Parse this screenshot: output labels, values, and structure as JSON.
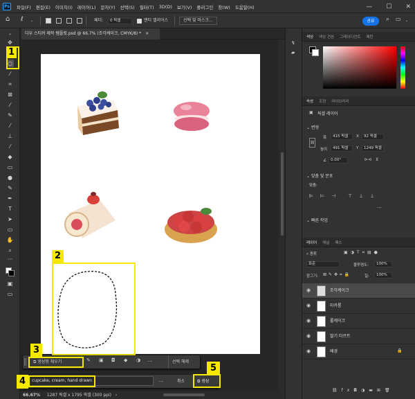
{
  "menu": {
    "items": [
      "파일(F)",
      "편집(E)",
      "이미지(I)",
      "레이어(L)",
      "문자(Y)",
      "선택(S)",
      "필터(T)",
      "3D(D)",
      "보기(V)",
      "플러그인",
      "창(W)",
      "도움말(H)"
    ],
    "logo": "Ps"
  },
  "window_controls": {
    "minimize": "—",
    "maximize": "☐",
    "close": "✕"
  },
  "options": {
    "feather_label": "페더:",
    "feather_value": "0 픽셀",
    "antialias_label": "앤티 앨리어스",
    "select_mask_label": "선택 및 마스크...",
    "share_label": "공유"
  },
  "document": {
    "tab_title": "디우 스티커 제작 템플릿.psd @ 66.7% (조각케이크, CMYK/8) *",
    "tab_close": "×"
  },
  "status": {
    "zoom": "66.67%",
    "doc_info": "1287 픽셀 x 1795 픽셀 (300 ppi)",
    "arrow": "›"
  },
  "color_panel": {
    "tabs": [
      "색상",
      "색상 견본",
      "그레이디언트",
      "패턴"
    ],
    "accent": "#ff0000"
  },
  "properties_panel": {
    "tabs": [
      "속성",
      "조정",
      "라이브러리"
    ],
    "layer_kind": "픽셀 레이어",
    "transform_title": "변형",
    "w_label": "폭",
    "w_value": "415 픽셀",
    "x_label": "X",
    "x_value": "92 픽셀",
    "h_label": "높이",
    "h_value": "491 픽셀",
    "y_label": "Y",
    "y_value": "1249 픽셀",
    "angle_value": "0.00°",
    "align_title": "맞춤 및 분포",
    "align_label": "맞춤:",
    "more": "...",
    "quick_title": "빠른 작업"
  },
  "layers_panel": {
    "tabs": [
      "레이어",
      "채널",
      "패스"
    ],
    "filter_kind": "종류",
    "blend_mode": "표준",
    "opacity_label": "불투명도:",
    "opacity_value": "100%",
    "lock_label": "잠그기:",
    "fill_label": "칠:",
    "fill_value": "100%",
    "layers": [
      {
        "name": "조각케이크",
        "selected": true
      },
      {
        "name": "마카롱",
        "selected": false
      },
      {
        "name": "롤케이크",
        "selected": false
      },
      {
        "name": "딸기 타르트",
        "selected": false
      },
      {
        "name": "배경",
        "selected": false,
        "locked": true
      }
    ]
  },
  "contextual_taskbar": {
    "generative_fill_label": "생성형 채우기",
    "deselect_label": "선택 해제",
    "more": "..."
  },
  "generate_bar": {
    "prompt_value": "cupcake, cream, hand drawn",
    "more": "...",
    "cancel_label": "취소",
    "generate_label": "생성"
  },
  "callouts": [
    "1",
    "2",
    "3",
    "4",
    "5"
  ],
  "colors": {
    "highlight": "#f5e900",
    "accent": "#1473e6",
    "panel": "#323232"
  }
}
